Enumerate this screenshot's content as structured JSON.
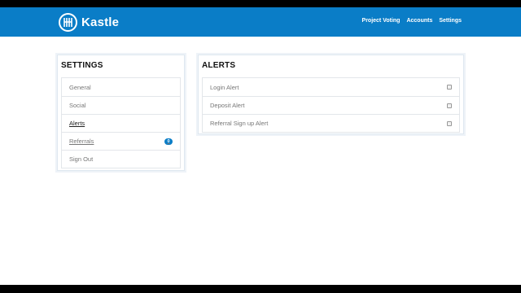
{
  "brand": {
    "name": "Kastle"
  },
  "nav": {
    "items": [
      "Project Voting",
      "Accounts",
      "Settings"
    ]
  },
  "settings": {
    "title": "SETTINGS",
    "items": [
      {
        "label": "General"
      },
      {
        "label": "Social"
      },
      {
        "label": "Alerts"
      },
      {
        "label": "Referrals",
        "badge": "0"
      },
      {
        "label": "Sign Out"
      }
    ]
  },
  "alerts": {
    "title": "ALERTS",
    "items": [
      {
        "label": "Login Alert",
        "checked": false
      },
      {
        "label": "Deposit Alert",
        "checked": false
      },
      {
        "label": "Referral Sign up Alert",
        "checked": false
      }
    ]
  },
  "colors": {
    "brand": "#0a7dc7",
    "badge": "#0a7dc7"
  }
}
